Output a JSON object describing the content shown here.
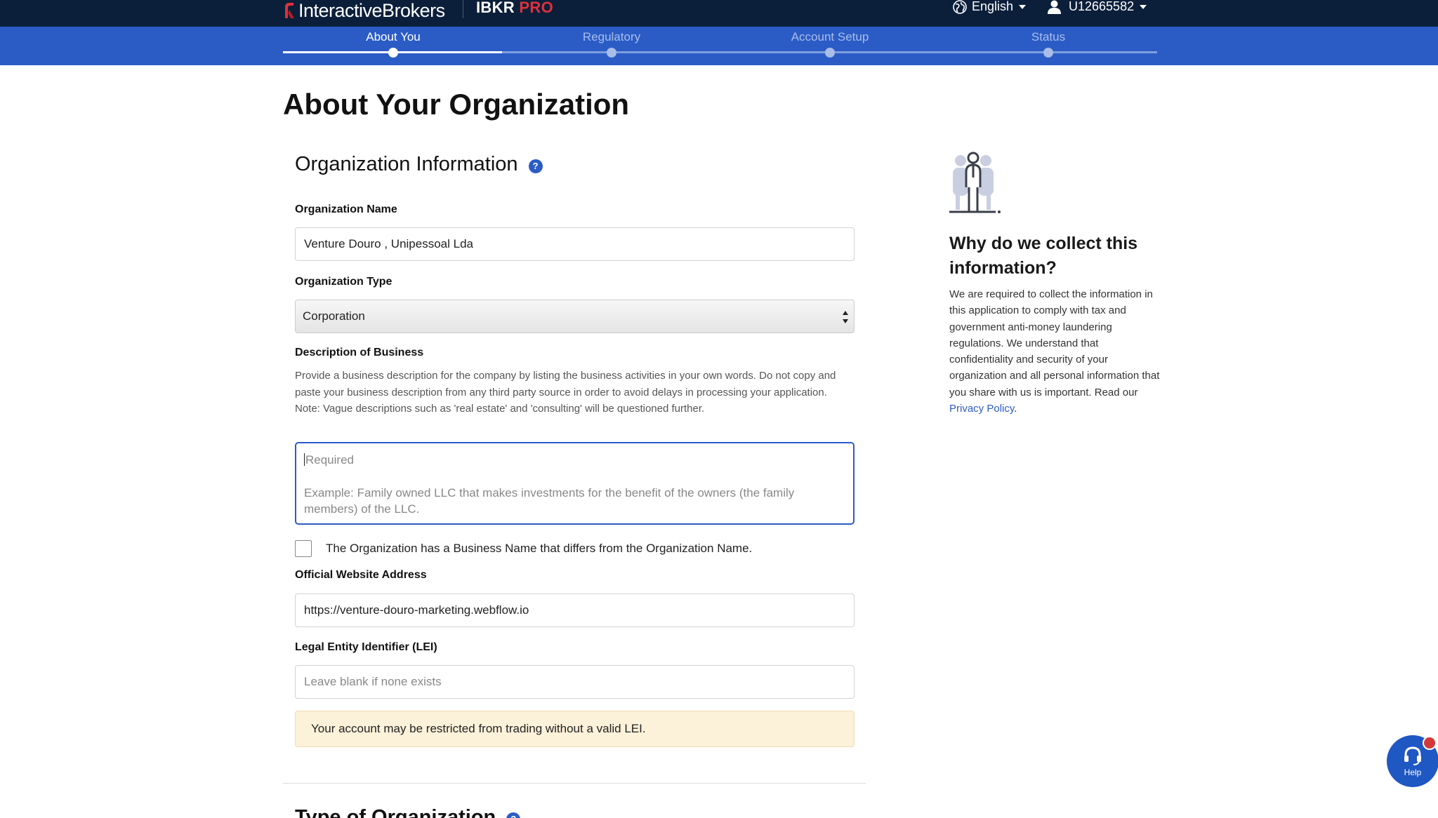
{
  "header": {
    "brand_name": "InteractiveBrokers",
    "product_name": "IBKR",
    "product_suffix": "PRO",
    "language": "English",
    "user_id": "U12665582"
  },
  "steps": [
    {
      "label": "About You",
      "active": true
    },
    {
      "label": "Regulatory",
      "active": false
    },
    {
      "label": "Account Setup",
      "active": false
    },
    {
      "label": "Status",
      "active": false
    }
  ],
  "page": {
    "title": "About Your Organization"
  },
  "org_info": {
    "section_title": "Organization Information",
    "help_icon": "?",
    "name_label": "Organization Name",
    "name_value": "Venture Douro , Unipessoal Lda",
    "type_label": "Organization Type",
    "type_value": "Corporation",
    "description_label": "Description of Business",
    "description_help_1": "Provide a business description for the company by listing the business activities in your own words. Do not copy and paste your business description from any third party source in order to avoid delays in processing your application.",
    "description_help_2": "Note: Vague descriptions such as 'real estate' and 'consulting' will be questioned further.",
    "description_placeholder_required": "Required",
    "description_placeholder_example": "Example: Family owned LLC that makes investments for the benefit of the owners (the family members) of the LLC.",
    "business_name_checkbox_label": "The Organization has a Business Name that differs from the Organization Name.",
    "website_label": "Official Website Address",
    "website_value": "https://venture-douro-marketing.webflow.io",
    "lei_label": "Legal Entity Identifier (LEI)",
    "lei_placeholder": "Leave blank if none exists",
    "lei_warning": "Your account may be restricted from trading without a valid LEI."
  },
  "next_section": {
    "title": "Type of Organization"
  },
  "sidebar": {
    "title": "Why do we collect this information?",
    "body": "We are required to collect the information in this application to comply with tax and government anti-money laundering regulations. We understand that confidentiality and security of your organization and all personal information that you share with us is important. Read our ",
    "link": "Privacy Policy",
    "trailing": "."
  },
  "help_fab": {
    "label": "Help"
  },
  "colors": {
    "navbar": "#0b1f3a",
    "stepband": "#2b5cc6",
    "accent": "#2b5cc6",
    "pro_red": "#e0303a",
    "warning_bg": "#fcf1d9"
  }
}
